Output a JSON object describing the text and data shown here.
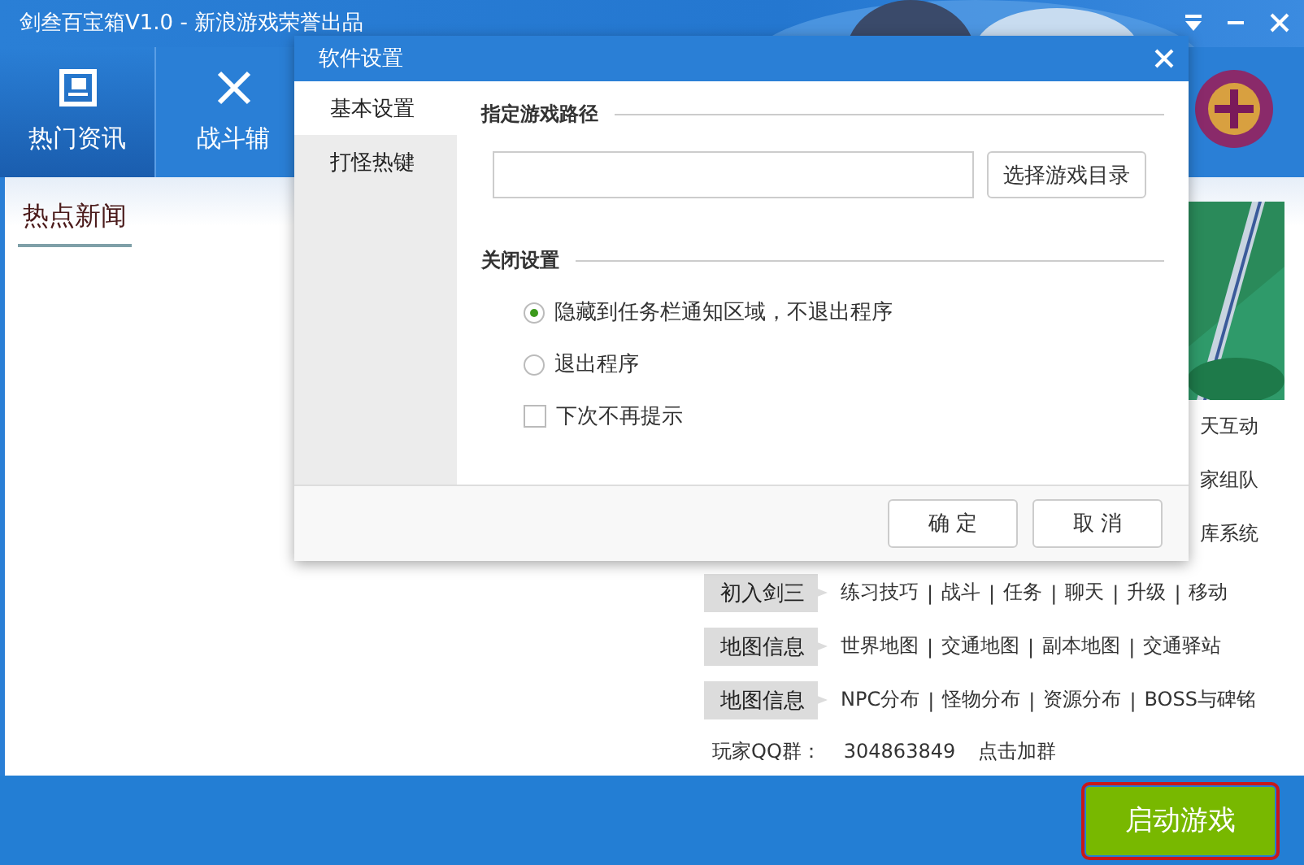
{
  "window": {
    "title": "剑叁百宝箱V1.0 - 新浪游戏荣誉出品"
  },
  "nav_tabs": [
    {
      "label": "热门资讯",
      "kind": "news",
      "selected": true
    },
    {
      "label": "战斗辅",
      "kind": "swords",
      "selected": false
    }
  ],
  "news_panel": {
    "heading": "热点新闻"
  },
  "side_snippets": [
    "天互动",
    "家组队",
    "库系统"
  ],
  "guide_rows": [
    {
      "tag": "初入剑三",
      "separator": "|",
      "links": [
        "练习技巧",
        "战斗",
        "任务",
        "聊天",
        "升级",
        "移动"
      ]
    },
    {
      "tag": "地图信息",
      "separator": "|",
      "links": [
        "世界地图",
        "交通地图",
        "副本地图",
        "交通驿站"
      ]
    },
    {
      "tag": "地图信息",
      "separator": "|",
      "links": [
        "NPC分布",
        "怪物分布",
        "资源分布",
        "BOSS与碑铭"
      ]
    }
  ],
  "qq": {
    "label": "玩家QQ群：",
    "number": "304863849",
    "action": "点击加群"
  },
  "launch_button": {
    "label": "启动游戏",
    "highlighted": true
  },
  "dialog": {
    "title": "软件设置",
    "sidebar": [
      {
        "label": "基本设置",
        "selected": true
      },
      {
        "label": "打怪热键",
        "selected": false
      }
    ],
    "path_section": {
      "heading": "指定游戏路径",
      "button": "选择游戏目录"
    },
    "close_section": {
      "heading": "关闭设置",
      "radios": [
        {
          "label": "隐藏到任务栏通知区域，不退出程序",
          "selected": true
        },
        {
          "label": "退出程序",
          "selected": false
        }
      ],
      "checkbox": {
        "label": "下次不再提示",
        "checked": false
      }
    },
    "buttons": [
      "确 定",
      "取 消"
    ]
  }
}
